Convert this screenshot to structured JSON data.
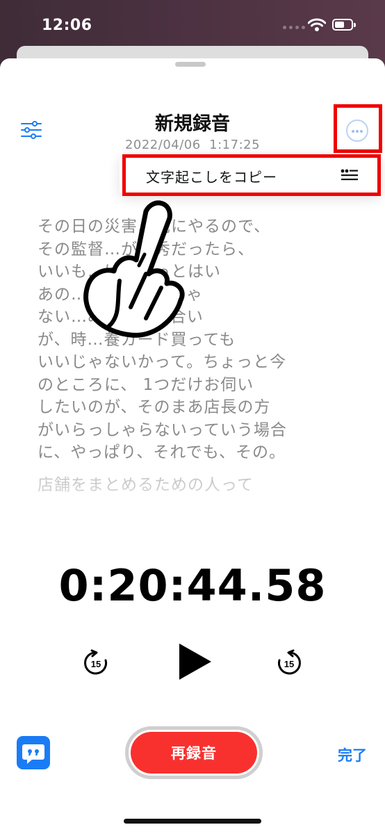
{
  "status_bar": {
    "time": "12:06"
  },
  "header": {
    "title": "新規録音",
    "date": "2022/04/06",
    "time": "1:17:25"
  },
  "context_menu": {
    "copy_transcript_label": "文字起こしをコピー"
  },
  "transcript": {
    "lines": [
      "その日の災害…先にやるので、",
      "その監督…が優秀だったら、",
      "いいも…はちょっとはい",
      "あの…として、指じゃ",
      "ない…みんで話し合い",
      "が、時…養カード買っても",
      "いいじゃないかって。ちょっと今",
      "のところに、 1つだけお伺い",
      "したいのが、そのまあ店長の方",
      "がいらっしゃらないっていう場合",
      "に、やっぱり、それでも、その。"
    ],
    "next_paragraph_start": "店舗をまとめるための人って"
  },
  "player": {
    "elapsed": "0:20:44.58",
    "skip_seconds": "15"
  },
  "footer": {
    "rerecord_label": "再録音",
    "done_label": "完了"
  },
  "colors": {
    "accent": "#1a7cf5",
    "record": "#f8312f",
    "highlight": "#ef0000"
  }
}
